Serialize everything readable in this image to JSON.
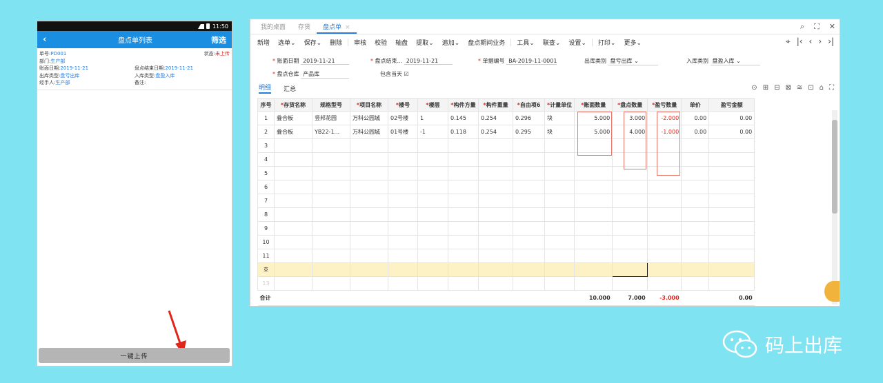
{
  "phone": {
    "status_time": "11:50",
    "title": "盘点单列表",
    "back": "‹",
    "filter": "筛选",
    "card": {
      "no_label": "单号:",
      "no_value": "PD001",
      "status_label": "状态:",
      "status_value": "未上传",
      "dept_label": "部门:",
      "dept_value": "生产部",
      "book_date_label": "账面日期:",
      "book_date_value": "2019-11-21",
      "end_date_label": "盘点结束日期:",
      "end_date_value": "2019-11-21",
      "out_type_label": "出库类型:",
      "out_type_value": "盘亏出库",
      "in_type_label": "入库类型:",
      "in_type_value": "盘盈入库",
      "handler_label": "经手人:",
      "handler_value": "生产部",
      "remark_label": "备注:",
      "remark_value": ""
    },
    "upload_button": "一键上传",
    "colors": {
      "appbar": "#1a8ee0",
      "accent": "#2a7bd8",
      "status_red": "#e0261b"
    }
  },
  "desktop": {
    "tabs": [
      {
        "label": "我的桌面"
      },
      {
        "label": "存货"
      },
      {
        "label": "盘点单",
        "close": "×"
      }
    ],
    "window_controls": [
      "⌕",
      "⛶",
      "✕"
    ],
    "toolbar": [
      "新增",
      "选单⌄",
      "保存⌄",
      "删除",
      "审核",
      "校验",
      "轴盘",
      "提取⌄",
      "追加⌄",
      "盘点期间业务",
      "工具⌄",
      "联查⌄",
      "设置⌄",
      "打印⌄",
      "更多⌄"
    ],
    "nav_controls": [
      "⌖",
      "|‹",
      "‹",
      "›",
      "›|"
    ],
    "form": {
      "book_date_label": "账面日期",
      "book_date": "2019-11-21",
      "end_date_label": "盘点结束...",
      "end_date": "2019-11-21",
      "doc_no_label": "单据编号",
      "doc_no": "BA-2019-11-0001",
      "out_type_label": "出库类别",
      "out_type": "盘亏出库",
      "in_type_label": "入库类别",
      "in_type": "盘盈入库",
      "warehouse_label": "盘点仓库",
      "warehouse": "产品库",
      "include_today_label": "包含当天",
      "include_today_check": "☑"
    },
    "subtabs": [
      "明细",
      "汇总"
    ],
    "grid_icons": [
      "⊙",
      "⊞",
      "⊟",
      "⊠",
      "≋",
      "⊡",
      "⌂",
      "⛶"
    ],
    "table": {
      "headers": [
        {
          "label": "序号",
          "required": false
        },
        {
          "label": "存货名称",
          "required": true
        },
        {
          "label": "规格型号",
          "required": false
        },
        {
          "label": "项目名称",
          "required": true
        },
        {
          "label": "楼号",
          "required": true
        },
        {
          "label": "楼层",
          "required": true
        },
        {
          "label": "构件方量",
          "required": true
        },
        {
          "label": "构件重量",
          "required": true
        },
        {
          "label": "自由项6",
          "required": true
        },
        {
          "label": "计量单位",
          "required": true
        },
        {
          "label": "账面数量",
          "required": true
        },
        {
          "label": "盘点数量",
          "required": true
        },
        {
          "label": "盈亏数量",
          "required": true
        },
        {
          "label": "单价",
          "required": false
        },
        {
          "label": "盈亏金额",
          "required": false
        }
      ],
      "rows": [
        [
          "1",
          "叠合板",
          "竖邦花园",
          "万科公园城",
          "02号楼",
          "1",
          "0.145",
          "0.254",
          "0.296",
          "块",
          "5.000",
          "3.000",
          "-2.000",
          "0.00",
          "0.00"
        ],
        [
          "2",
          "叠合板",
          "YB22-1...",
          "万科公园城",
          "01号楼",
          "-1",
          "0.118",
          "0.254",
          "0.295",
          "块",
          "5.000",
          "4.000",
          "-1.000",
          "0.00",
          "0.00"
        ],
        [
          "3",
          "",
          "",
          "",
          "",
          "",
          "",
          "",
          "",
          "",
          "",
          "",
          "",
          "",
          ""
        ],
        [
          "4",
          "",
          "",
          "",
          "",
          "",
          "",
          "",
          "",
          "",
          "",
          "",
          "",
          "",
          ""
        ],
        [
          "5",
          "",
          "",
          "",
          "",
          "",
          "",
          "",
          "",
          "",
          "",
          "",
          "",
          "",
          ""
        ],
        [
          "6",
          "",
          "",
          "",
          "",
          "",
          "",
          "",
          "",
          "",
          "",
          "",
          "",
          "",
          ""
        ],
        [
          "7",
          "",
          "",
          "",
          "",
          "",
          "",
          "",
          "",
          "",
          "",
          "",
          "",
          "",
          ""
        ],
        [
          "8",
          "",
          "",
          "",
          "",
          "",
          "",
          "",
          "",
          "",
          "",
          "",
          "",
          "",
          ""
        ],
        [
          "9",
          "",
          "",
          "",
          "",
          "",
          "",
          "",
          "",
          "",
          "",
          "",
          "",
          "",
          ""
        ],
        [
          "10",
          "",
          "",
          "",
          "",
          "",
          "",
          "",
          "",
          "",
          "",
          "",
          "",
          "",
          ""
        ],
        [
          "11",
          "",
          "",
          "",
          "",
          "",
          "",
          "",
          "",
          "",
          "",
          "",
          "",
          "",
          ""
        ]
      ],
      "new_row_marker": "호",
      "dim_row": "13",
      "total_label": "合计",
      "totals": {
        "book_qty": "10.000",
        "count_qty": "7.000",
        "diff_qty": "-3.000",
        "diff_amount": "0.00"
      }
    },
    "colors": {
      "accent": "#2a7bd8",
      "negative": "#e0261b",
      "highlight_box": "#e57368",
      "new_row": "#fdf1c6"
    }
  },
  "watermark": {
    "text": "码上出库"
  }
}
